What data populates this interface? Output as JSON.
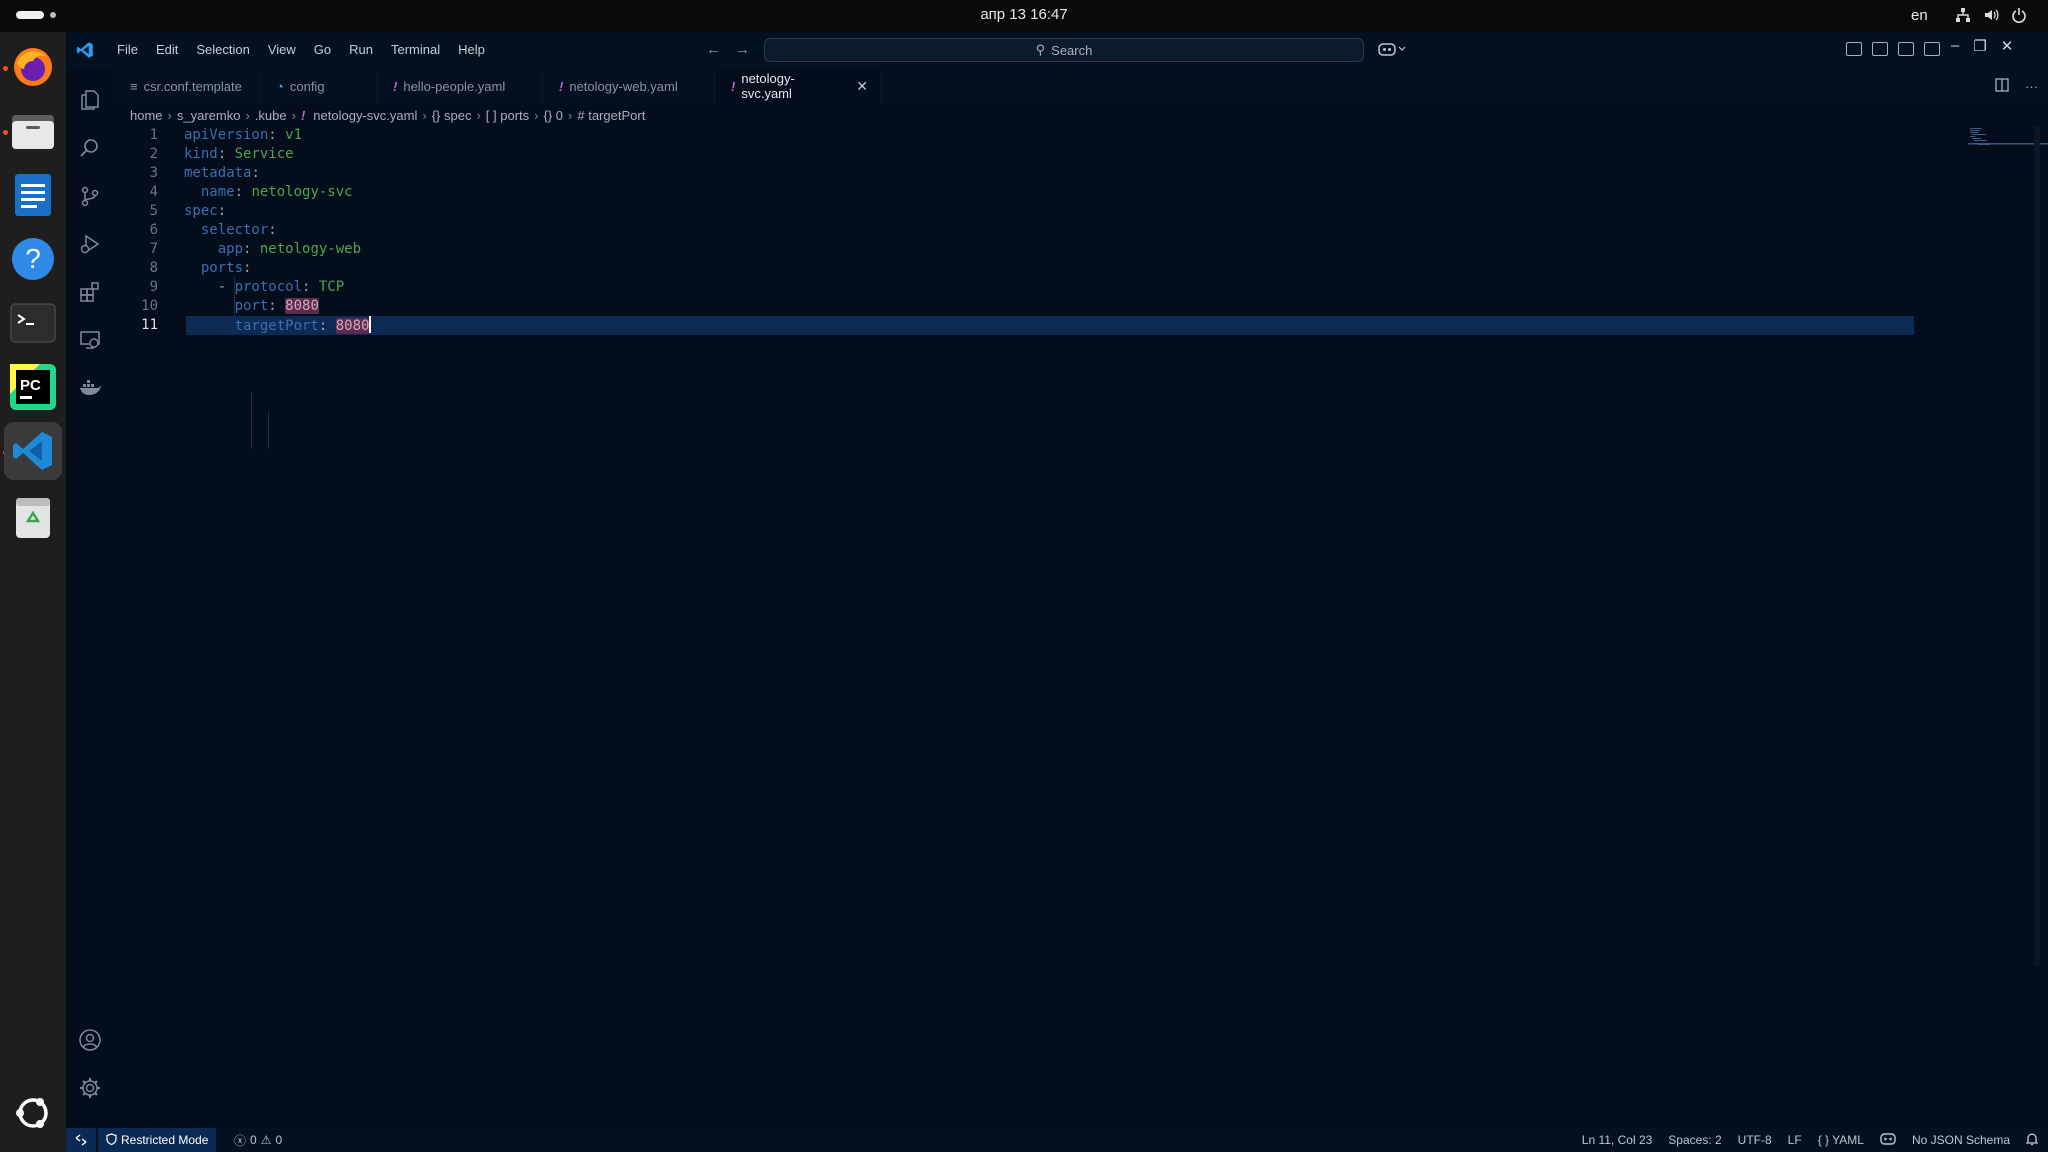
{
  "system": {
    "clock": "апр 13  16:47",
    "language": "en"
  },
  "dock": {
    "apps": [
      "firefox-icon",
      "files-icon",
      "writer-icon",
      "help-icon",
      "terminal-icon",
      "pycharm-icon",
      "vscode-icon",
      "trash-icon",
      "ubuntu-icon"
    ]
  },
  "titlebar": {
    "menu": [
      "File",
      "Edit",
      "Selection",
      "View",
      "Go",
      "Run",
      "Terminal",
      "Help"
    ],
    "search_placeholder": "Search"
  },
  "tabs": [
    {
      "label": "csr.conf.template",
      "icon": "≡"
    },
    {
      "label": "config",
      "icon": "◔"
    },
    {
      "label": "hello-people.yaml",
      "icon": "!"
    },
    {
      "label": "netology-web.yaml",
      "icon": "!"
    },
    {
      "label": "netology-svc.yaml",
      "icon": "!"
    }
  ],
  "breadcrumb": {
    "home": "home",
    "user": "s_yaremko",
    "dir": ".kube",
    "file": "netology-svc.yaml",
    "spec": "{} spec",
    "ports": "[ ] ports",
    "index": "{} 0",
    "leaf": "# targetPort"
  },
  "editor": {
    "lines": [
      {
        "n": "1",
        "k": "apiVersion",
        "v": "v1"
      },
      {
        "n": "2",
        "k": "kind",
        "v": "Service"
      },
      {
        "n": "3",
        "k": "metadata",
        "v": ""
      },
      {
        "n": "4",
        "k": "name",
        "v": "netology-svc"
      },
      {
        "n": "5",
        "k": "spec",
        "v": ""
      },
      {
        "n": "6",
        "k": "selector",
        "v": ""
      },
      {
        "n": "7",
        "k": "app",
        "v": "netology-web"
      },
      {
        "n": "8",
        "k": "ports",
        "v": ""
      },
      {
        "n": "9",
        "k": "protocol",
        "v": "TCP"
      },
      {
        "n": "10",
        "k": "port",
        "v": "8080"
      },
      {
        "n": "11",
        "k": "targetPort",
        "v": "8080"
      }
    ]
  },
  "status": {
    "restricted": "Restricted Mode",
    "errors": "0",
    "warnings": "0",
    "position": "Ln 11, Col 23",
    "spaces": "Spaces: 2",
    "encoding": "UTF-8",
    "eol": "LF",
    "language": "YAML",
    "schema": "No JSON Schema"
  }
}
